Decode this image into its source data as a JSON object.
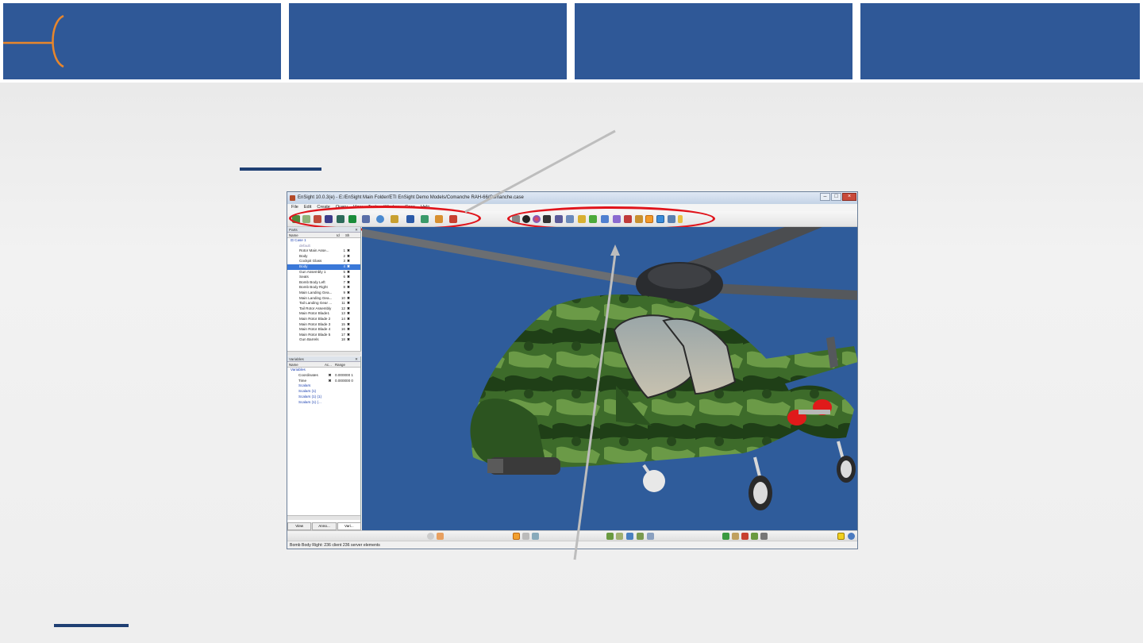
{
  "window": {
    "title": "EnSight 10.0.3(e) - E:/EnSight Main Folder/ETI EnSight Demo Models/Comanche RAH-66/Comanche.case",
    "controls": [
      "–",
      "□",
      "×"
    ]
  },
  "menu": [
    "File",
    "Edit",
    "Create",
    "Query",
    "View",
    "Tools",
    "Window",
    "Case",
    "Help"
  ],
  "parts_panel": {
    "title": "Parts",
    "columns": [
      "Name",
      "Id",
      "Sh"
    ],
    "case_name": "Case 1",
    "items": [
      {
        "name": "default",
        "id": "",
        "vis": ""
      },
      {
        "name": "Rotor Main Asse...",
        "id": "1",
        "vis": "✖"
      },
      {
        "name": "Body",
        "id": "2",
        "vis": "✖"
      },
      {
        "name": "Cockpit Glass",
        "id": "3",
        "vis": "✖"
      },
      {
        "name": "Body",
        "id": "4",
        "vis": "✖",
        "selected": true
      },
      {
        "name": "Gun Assembly 1",
        "id": "5",
        "vis": "✖"
      },
      {
        "name": "Seats",
        "id": "6",
        "vis": "✖"
      },
      {
        "name": "Bomb Body Left",
        "id": "7",
        "vis": "✖"
      },
      {
        "name": "Bomb Body Right",
        "id": "8",
        "vis": "✖"
      },
      {
        "name": "Main Landing Gea...",
        "id": "9",
        "vis": "✖"
      },
      {
        "name": "Main Landing Gea...",
        "id": "10",
        "vis": "✖"
      },
      {
        "name": "Tail Landing Gear ...",
        "id": "11",
        "vis": "✖"
      },
      {
        "name": "Tail Rotor Assembly",
        "id": "12",
        "vis": "✖"
      },
      {
        "name": "Main Rotor Blade1",
        "id": "13",
        "vis": "✖"
      },
      {
        "name": "Main Rotor Blade 2",
        "id": "14",
        "vis": "✖"
      },
      {
        "name": "Main Rotor Blade 3",
        "id": "15",
        "vis": "✖"
      },
      {
        "name": "Main Rotor Blade 4",
        "id": "16",
        "vis": "✖"
      },
      {
        "name": "Main Rotor Blade 5",
        "id": "17",
        "vis": "✖"
      },
      {
        "name": "Gun Barrels",
        "id": "18",
        "vis": "✖"
      }
    ]
  },
  "variables_panel": {
    "title": "Variables",
    "columns": [
      "Name",
      "Ac...",
      "Range"
    ],
    "items": [
      {
        "name": "Variables",
        "indent": 0,
        "ac": "",
        "range": ""
      },
      {
        "name": "Coordinates",
        "indent": 1,
        "ac": "✖",
        "range": "0.000000  1"
      },
      {
        "name": "Time",
        "indent": 1,
        "ac": "✖",
        "range": "0.000000  0"
      },
      {
        "name": "Scalars",
        "indent": 1,
        "ac": "",
        "range": ""
      },
      {
        "name": "Scalars (1)",
        "indent": 1,
        "ac": "",
        "range": ""
      },
      {
        "name": "Scalars (1) (1)",
        "indent": 1,
        "ac": "",
        "range": ""
      },
      {
        "name": "Scalars (1) (...",
        "indent": 1,
        "ac": "",
        "range": ""
      }
    ]
  },
  "tabs": [
    "View",
    "Anno...",
    "Vari..."
  ],
  "status": "Bomb Body Right: 236 client 236 server elements",
  "colors": {
    "banner": "#2f5897",
    "accent": "#e8862b",
    "highlight_ring": "#e0141b",
    "viewport_bg": "#2f5c9b",
    "selection": "#3a78d8"
  }
}
